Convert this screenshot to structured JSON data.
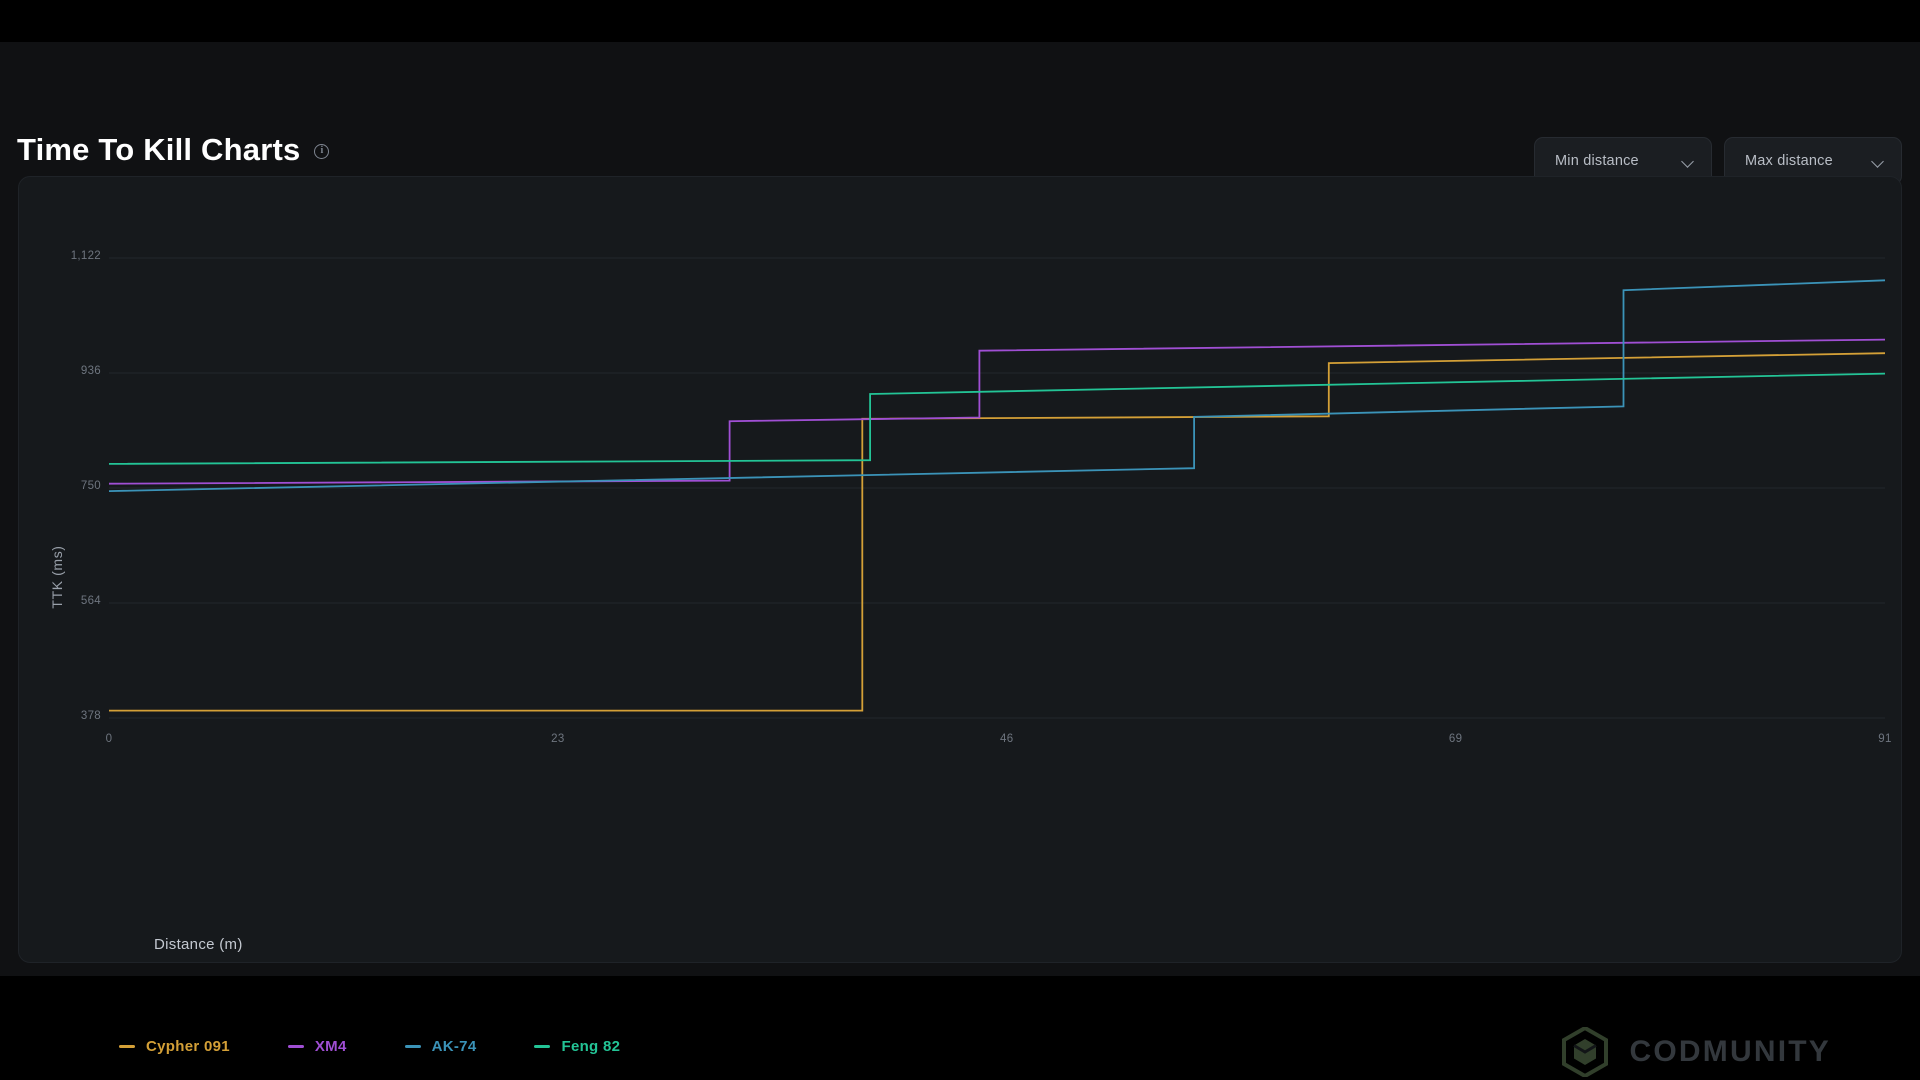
{
  "header": {
    "title": "Time To Kill Charts",
    "info_icon": "info-circle-icon",
    "controls": [
      {
        "label": "Min distance",
        "icon": "chevron-down-icon"
      },
      {
        "label": "Max distance",
        "icon": "chevron-down-icon"
      }
    ]
  },
  "watermark": {
    "text": "CODMUNITY",
    "icon": "hexagon-logo-icon",
    "color": "#3a4b33"
  },
  "chart_data": {
    "type": "line",
    "title": "Time To Kill Charts",
    "xlabel": "Distance (m)",
    "ylabel": "TTK (ms)",
    "xlim": [
      0,
      91
    ],
    "ylim": [
      378,
      1122
    ],
    "xticks": [
      "0",
      "23",
      "46",
      "69",
      "91"
    ],
    "xtick_values": [
      0,
      23,
      46,
      69,
      91
    ],
    "yticks": [
      "378",
      "564",
      "750",
      "936",
      "1,122"
    ],
    "ytick_values": [
      378,
      564,
      750,
      936,
      1122
    ],
    "grid": true,
    "legend_position": "bottom-left",
    "step_style": "post",
    "series": [
      {
        "name": "Cypher 091",
        "color": "#d4a037",
        "points": [
          [
            0,
            390
          ],
          [
            38.6,
            390
          ],
          [
            38.6,
            862
          ],
          [
            62.5,
            866
          ],
          [
            62.5,
            952
          ],
          [
            91,
            968
          ]
        ]
      },
      {
        "name": "XM4",
        "color": "#a04fd4",
        "points": [
          [
            0,
            757
          ],
          [
            31.8,
            762
          ],
          [
            31.8,
            858
          ],
          [
            44.6,
            864
          ],
          [
            44.6,
            972
          ],
          [
            91,
            990
          ]
        ]
      },
      {
        "name": "AK-74",
        "color": "#3b93b8",
        "points": [
          [
            0,
            745
          ],
          [
            55.6,
            782
          ],
          [
            55.6,
            865
          ],
          [
            77.6,
            882
          ],
          [
            77.6,
            1070
          ],
          [
            91,
            1086
          ]
        ]
      },
      {
        "name": "Feng 82",
        "color": "#23c496",
        "points": [
          [
            0,
            789
          ],
          [
            39.0,
            795
          ],
          [
            39.0,
            902
          ],
          [
            91,
            935
          ]
        ]
      }
    ]
  }
}
